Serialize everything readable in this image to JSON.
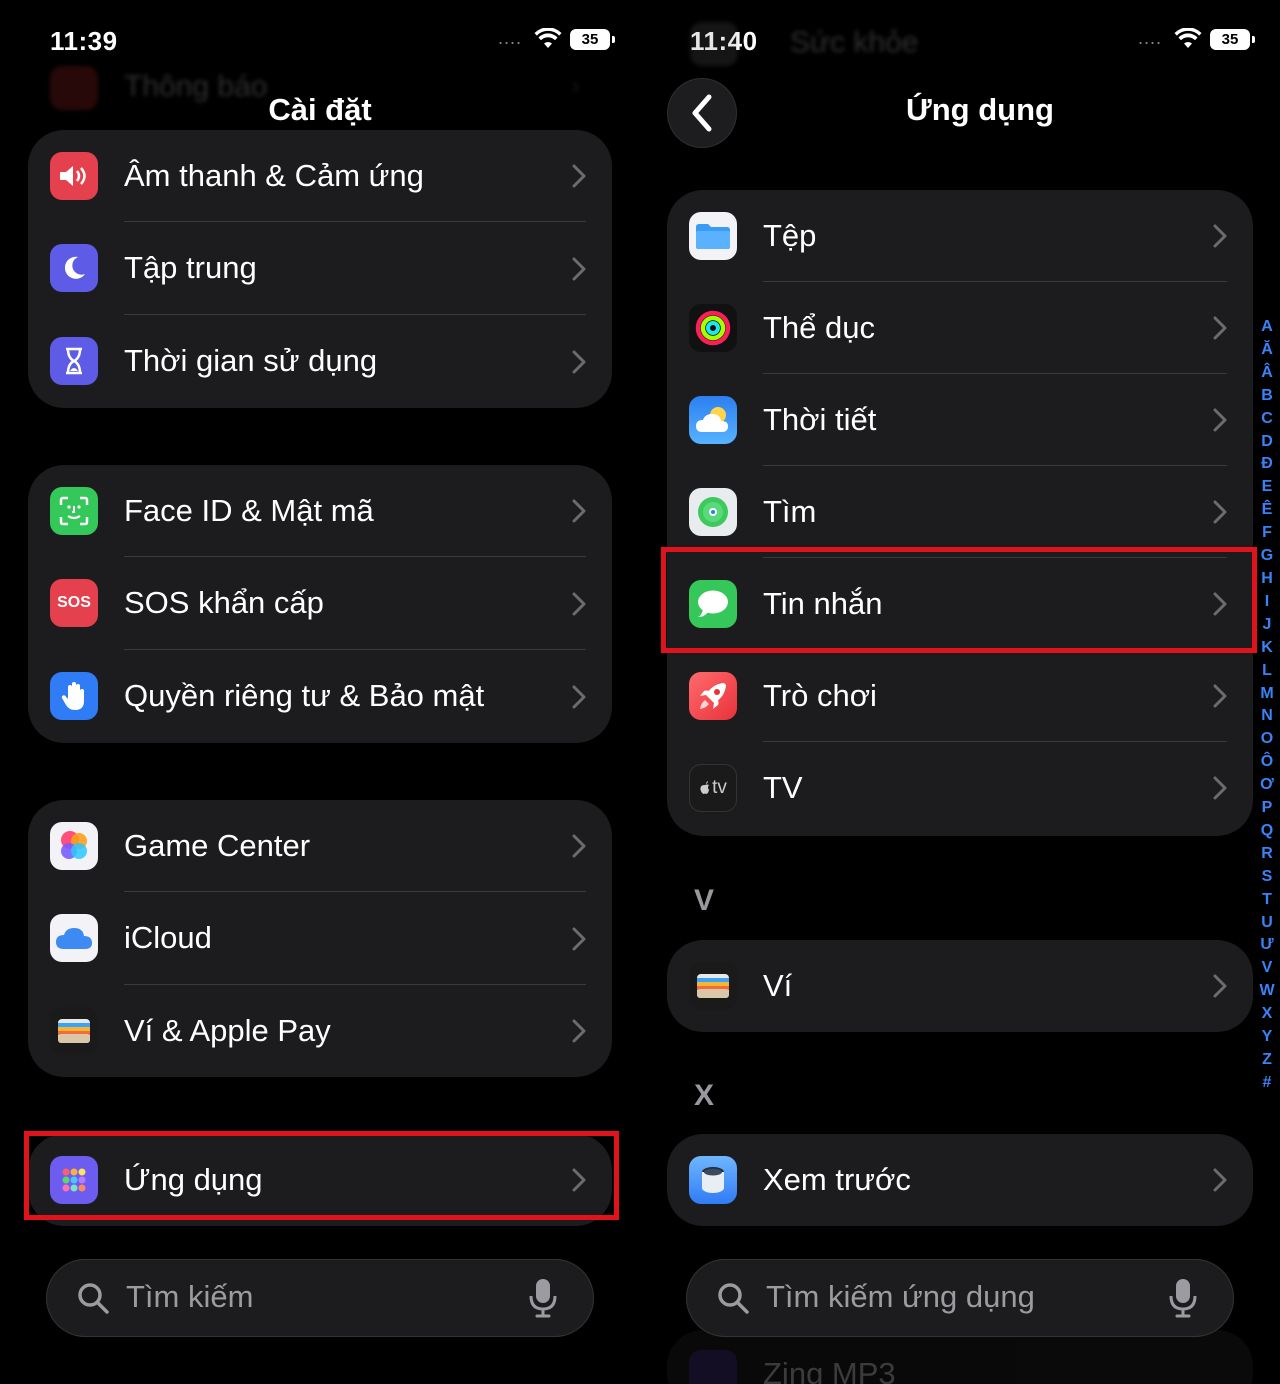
{
  "left": {
    "status": {
      "time": "11:39",
      "signal": "....",
      "battery": "35"
    },
    "ghost_row": "Thông báo",
    "title": "Cài đặt",
    "group1": [
      {
        "label": "Âm thanh & Cảm ứng",
        "icon": "speaker-icon"
      },
      {
        "label": "Tập trung",
        "icon": "moon-icon"
      },
      {
        "label": "Thời gian sử dụng",
        "icon": "hourglass-icon"
      }
    ],
    "group2": [
      {
        "label": "Face ID & Mật mã",
        "icon": "face-id-icon"
      },
      {
        "label": "SOS khẩn cấp",
        "icon": "sos-icon",
        "icon_text": "SOS"
      },
      {
        "label": "Quyền riêng tư & Bảo mật",
        "icon": "hand-icon"
      }
    ],
    "group3": [
      {
        "label": "Game Center",
        "icon": "game-center-icon"
      },
      {
        "label": "iCloud",
        "icon": "cloud-icon"
      },
      {
        "label": "Ví & Apple Pay",
        "icon": "wallet-icon"
      }
    ],
    "group4": [
      {
        "label": "Ứng dụng",
        "icon": "apps-grid-icon"
      }
    ],
    "search": {
      "placeholder": "Tìm kiếm"
    }
  },
  "right": {
    "status": {
      "time": "11:40",
      "signal": "....",
      "battery": "35"
    },
    "ghost_row": "Sức khỏe",
    "title": "Ứng dụng",
    "group1": [
      {
        "label": "Tệp",
        "icon": "folder-icon"
      },
      {
        "label": "Thể dục",
        "icon": "fitness-rings-icon"
      },
      {
        "label": "Thời tiết",
        "icon": "weather-icon"
      },
      {
        "label": "Tìm",
        "icon": "find-my-icon"
      },
      {
        "label": "Tin nhắn",
        "icon": "messages-icon"
      },
      {
        "label": "Trò chơi",
        "icon": "rocket-icon"
      },
      {
        "label": "TV",
        "icon": "apple-tv-icon",
        "icon_text": "tv"
      }
    ],
    "section_v": "V",
    "group2": [
      {
        "label": "Ví",
        "icon": "wallet-icon"
      }
    ],
    "section_x": "X",
    "group3": [
      {
        "label": "Xem trước",
        "icon": "preview-icon"
      }
    ],
    "search": {
      "placeholder": "Tìm kiếm ứng dụng"
    },
    "peek_row": "Zing MP3",
    "index": [
      "A",
      "Ă",
      "Â",
      "B",
      "C",
      "D",
      "Đ",
      "E",
      "Ê",
      "F",
      "G",
      "H",
      "I",
      "J",
      "K",
      "L",
      "M",
      "N",
      "O",
      "Ô",
      "Ơ",
      "P",
      "Q",
      "R",
      "S",
      "T",
      "U",
      "Ư",
      "V",
      "W",
      "X",
      "Y",
      "Z",
      "#"
    ]
  },
  "colors": {
    "highlight": "#e0121b",
    "index_blue": "#3a82f7",
    "cell_bg": "#1c1c1e"
  }
}
